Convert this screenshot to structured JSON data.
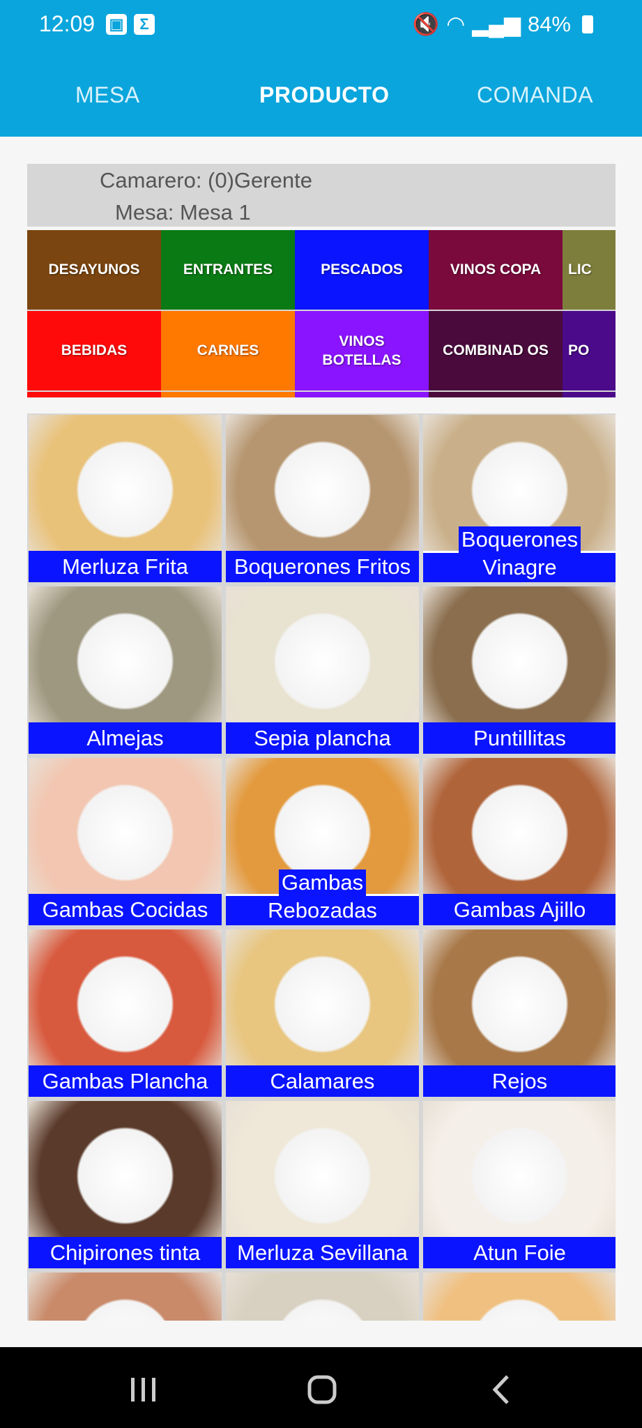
{
  "status": {
    "time": "12:09",
    "battery": "84%"
  },
  "tabs": [
    "MESA",
    "PRODUCTO",
    "COMANDA"
  ],
  "info": {
    "waiter": "Camarero: (0)Gerente",
    "table": "Mesa: Mesa 1"
  },
  "categories": [
    {
      "label": "DESAYUNOS",
      "color": "#7a4510"
    },
    {
      "label": "ENTRANTES",
      "color": "#0a7a14"
    },
    {
      "label": "PESCADOS",
      "color": "#0a14ff"
    },
    {
      "label": "VINOS COPA",
      "color": "#7a0a3c"
    },
    {
      "label": "LIC",
      "color": "#7e7e3c"
    },
    {
      "label": "BEBIDAS",
      "color": "#ff0a0a"
    },
    {
      "label": "CARNES",
      "color": "#ff7800"
    },
    {
      "label": "VINOS BOTELLAS",
      "color": "#8a14ff"
    },
    {
      "label": "COMBINAD OS",
      "color": "#4a0a3c"
    },
    {
      "label": "PO",
      "color": "#4a0a8a"
    }
  ],
  "products": [
    {
      "name": "Merluza Frita",
      "photo": "fried-hake-photo",
      "bg": "#e9c27a"
    },
    {
      "name": "Boquerones Fritos",
      "photo": "fried-anchovies-photo",
      "bg": "#b69670"
    },
    {
      "name": "Boquerones Vinagre",
      "photo": "pickled-anchovies-photo",
      "bg": "#c9b08a"
    },
    {
      "name": "Almejas",
      "photo": "clams-photo",
      "bg": "#9e9880"
    },
    {
      "name": "Sepia plancha",
      "photo": "grilled-cuttlefish-photo",
      "bg": "#e8e2d0"
    },
    {
      "name": "Puntillitas",
      "photo": "fried-baby-squid-photo",
      "bg": "#8a6e4e"
    },
    {
      "name": "Gambas Cocidas",
      "photo": "boiled-prawns-photo",
      "bg": "#f2c6b0"
    },
    {
      "name": "Gambas Rebozadas",
      "photo": "battered-prawns-photo",
      "bg": "#e39a3e"
    },
    {
      "name": "Gambas Ajillo",
      "photo": "garlic-prawns-photo",
      "bg": "#b0643a"
    },
    {
      "name": "Gambas Plancha",
      "photo": "grilled-prawns-photo",
      "bg": "#d85a3e"
    },
    {
      "name": "Calamares",
      "photo": "fried-calamari-photo",
      "bg": "#e8c680"
    },
    {
      "name": "Rejos",
      "photo": "fried-octopus-tentacles-photo",
      "bg": "#a87848"
    },
    {
      "name": "Chipirones tinta",
      "photo": "squid-in-ink-photo",
      "bg": "#5a3a2a"
    },
    {
      "name": "Merluza Sevillana",
      "photo": "hake-sevillana-photo",
      "bg": "#efe8d8"
    },
    {
      "name": "Atun Foie",
      "photo": "tuna-foie-photo",
      "bg": "#f4efe8"
    },
    {
      "name": "",
      "photo": "octopus-dish-photo",
      "bg": "#c98a6a"
    },
    {
      "name": "",
      "photo": "fish-plate-photo",
      "bg": "#d8d0c0"
    },
    {
      "name": "",
      "photo": "fried-fish-photo",
      "bg": "#f0c080"
    }
  ]
}
